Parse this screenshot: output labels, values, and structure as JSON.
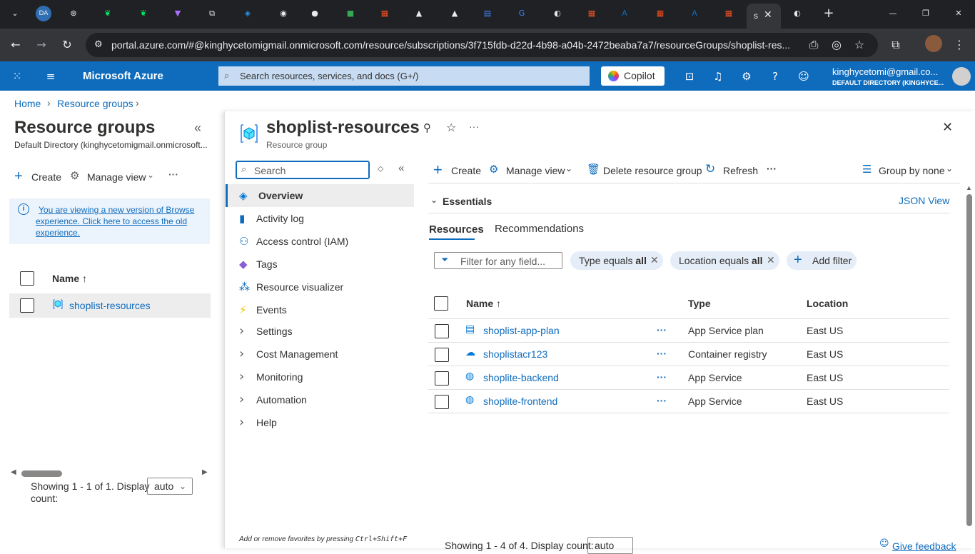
{
  "browser": {
    "tabs": [
      "DA",
      "",
      "",
      "",
      "",
      "",
      "",
      "",
      "",
      "",
      "",
      "",
      "",
      "",
      "",
      "",
      "",
      "",
      "",
      "",
      "",
      ""
    ],
    "active_tab": "s",
    "url": "portal.azure.com/#@kinghycetomigmail.onmicrosoft.com/resource/subscriptions/3f715fdb-d22d-4b98-a04b-2472beaba7a7/resourceGroups/shoplist-res..."
  },
  "azure": {
    "brand": "Microsoft Azure",
    "search_placeholder": "Search resources, services, and docs (G+/)",
    "copilot": "Copilot",
    "account_email": "kinghycetomi@gmail.co...",
    "account_dir": "DEFAULT DIRECTORY (KINGHYCE..."
  },
  "breadcrumb": {
    "home": "Home",
    "resource_groups": "Resource groups"
  },
  "left": {
    "title": "Resource groups",
    "subtitle": "Default Directory (kinghycetomigmail.onmicrosoft...",
    "create": "Create",
    "manage_view": "Manage view",
    "more": "···",
    "info_text": "You are viewing a new version of Browse experience. Click here to access the old experience.",
    "info_line1": "You are viewing a new version of Browse",
    "info_line2": "experience. Click here to access the old",
    "info_line3": "experience.",
    "col_name": "Name ↑",
    "row_name": "shoplist-resources",
    "showing_line1": "Showing 1 - 1 of 1. Display",
    "showing_line2": "count:",
    "count_value": "auto"
  },
  "detail": {
    "title": "shoplist-resources",
    "subtitle": "Resource group",
    "more": "···",
    "search_placeholder": "Search",
    "nav": [
      {
        "label": "Overview",
        "icon": "cube-icon"
      },
      {
        "label": "Activity log",
        "icon": "activity-log-icon"
      },
      {
        "label": "Access control (IAM)",
        "icon": "people-icon"
      },
      {
        "label": "Tags",
        "icon": "tag-icon"
      },
      {
        "label": "Resource visualizer",
        "icon": "visualizer-icon"
      },
      {
        "label": "Events",
        "icon": "lightning-icon"
      },
      {
        "label": "Settings",
        "icon": "chevron-right-icon"
      },
      {
        "label": "Cost Management",
        "icon": "chevron-right-icon"
      },
      {
        "label": "Monitoring",
        "icon": "chevron-right-icon"
      },
      {
        "label": "Automation",
        "icon": "chevron-right-icon"
      },
      {
        "label": "Help",
        "icon": "chevron-right-icon"
      }
    ],
    "favorites_hint": "Add or remove favorites by pressing",
    "favorites_keys": "Ctrl+Shift+F",
    "toolbar": {
      "create": "Create",
      "manage_view": "Manage view",
      "delete": "Delete resource group",
      "refresh": "Refresh",
      "more": "···",
      "group_by": "Group by none"
    },
    "essentials": "Essentials",
    "json_view": "JSON View",
    "tabs": [
      "Resources",
      "Recommendations"
    ],
    "filter_placeholder": "Filter for any field...",
    "filter_type_prefix": "Type equals ",
    "filter_type_value": "all",
    "filter_loc_prefix": "Location equals ",
    "filter_loc_value": "all",
    "add_filter": "Add filter",
    "columns": {
      "name": "Name ↑",
      "type": "Type",
      "location": "Location"
    },
    "rows": [
      {
        "name": "shoplist-app-plan",
        "type": "App Service plan",
        "location": "East US",
        "icon": "app-service-plan-icon"
      },
      {
        "name": "shoplistacr123",
        "type": "Container registry",
        "location": "East US",
        "icon": "container-registry-icon"
      },
      {
        "name": "shoplite-backend",
        "type": "App Service",
        "location": "East US",
        "icon": "app-service-icon"
      },
      {
        "name": "shoplite-frontend",
        "type": "App Service",
        "location": "East US",
        "icon": "app-service-icon"
      }
    ],
    "row_more": "···",
    "showing": "Showing 1 - 4 of 4. Display count:",
    "count_value": "auto",
    "feedback": "Give feedback"
  }
}
